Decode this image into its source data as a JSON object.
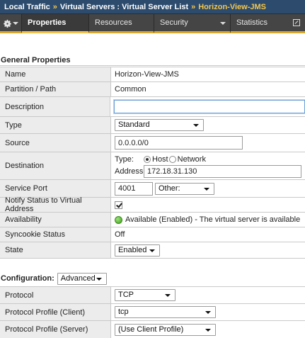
{
  "breadcrumb": {
    "items": [
      "Local Traffic",
      "Virtual Servers : Virtual Server List"
    ],
    "separator": "»",
    "current": "Horizon-View-JMS"
  },
  "tabs": [
    {
      "label": "Properties",
      "active": true
    },
    {
      "label": "Resources",
      "active": false
    },
    {
      "label": "Security",
      "active": false
    },
    {
      "label": "Statistics",
      "active": false
    }
  ],
  "general": {
    "title": "General Properties",
    "name": {
      "label": "Name",
      "value": "Horizon-View-JMS"
    },
    "partition": {
      "label": "Partition / Path",
      "value": "Common"
    },
    "description": {
      "label": "Description",
      "value": ""
    },
    "type": {
      "label": "Type",
      "value": "Standard"
    },
    "source": {
      "label": "Source",
      "value": "0.0.0.0/0"
    },
    "destination": {
      "label": "Destination",
      "type_label": "Type:",
      "option_host": "Host",
      "option_network": "Network",
      "selected": "Host",
      "address_label": "Address:",
      "address": "172.18.31.130"
    },
    "service_port": {
      "label": "Service Port",
      "port": "4001",
      "preset": "Other:"
    },
    "notify": {
      "label": "Notify Status to Virtual Address",
      "checked": true
    },
    "availability": {
      "label": "Availability",
      "value": "Available (Enabled) - The virtual server is available",
      "status_color": "#4caf29"
    },
    "syncookie": {
      "label": "Syncookie Status",
      "value": "Off"
    },
    "state": {
      "label": "State",
      "value": "Enabled"
    }
  },
  "configuration": {
    "title": "Configuration:",
    "mode": "Advanced",
    "protocol": {
      "label": "Protocol",
      "value": "TCP"
    },
    "profile_client": {
      "label": "Protocol Profile (Client)",
      "value": "tcp"
    },
    "profile_server": {
      "label": "Protocol Profile (Server)",
      "value": "(Use Client Profile)"
    }
  },
  "colors": {
    "header_bg": "#2c4b6d",
    "accent": "#f3c24c",
    "tab_bg": "#3e3e3e",
    "label_bg": "#ececec"
  }
}
